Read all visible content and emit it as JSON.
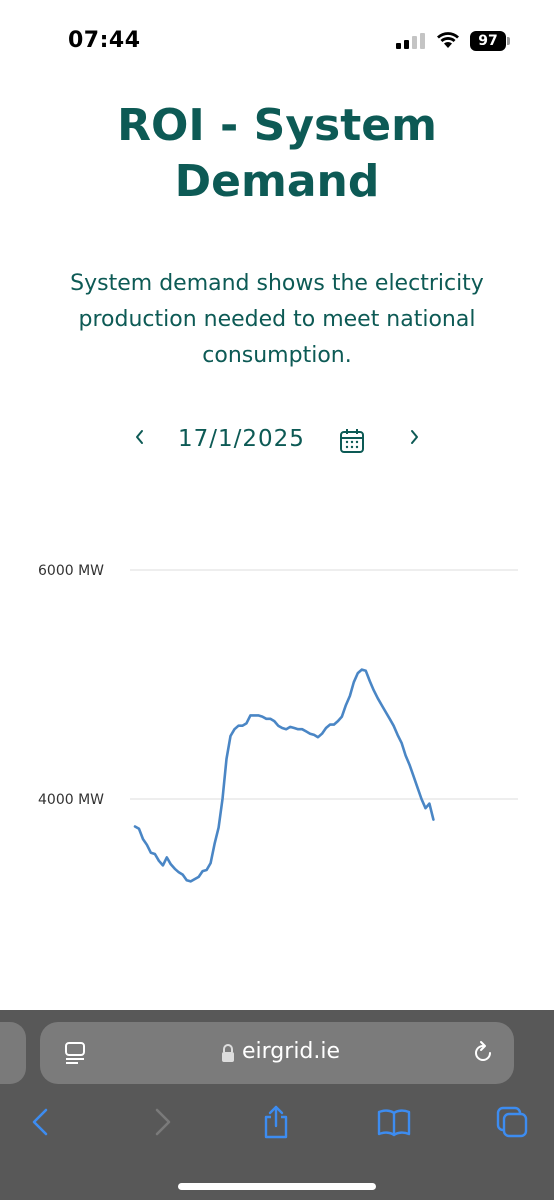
{
  "status_bar": {
    "time": "07:44",
    "battery": "97"
  },
  "header": {
    "title_line1": "ROI - System",
    "title_line2": "Demand",
    "description": "System demand shows the electricity production needed to meet national consumption."
  },
  "date_nav": {
    "date": "17/1/2025",
    "prev_icon": "chevron-left-icon",
    "next_icon": "chevron-right-icon",
    "calendar_icon": "calendar-icon"
  },
  "chart_data": {
    "type": "line",
    "title": "",
    "xlabel": "",
    "ylabel": "",
    "y_ticks": [
      "6000 MW",
      "4000 MW"
    ],
    "y_tick_values": [
      6000,
      4000
    ],
    "ylim": [
      3000,
      6400
    ],
    "grid": true,
    "legend": "none",
    "line_color": "#4a86c5",
    "x": [
      0,
      1,
      2,
      3,
      4,
      5,
      6,
      7,
      8,
      9,
      10,
      11,
      12,
      13,
      14,
      15,
      16,
      17,
      18,
      19,
      20,
      21,
      22,
      23,
      24,
      25,
      26,
      27,
      28,
      29,
      30,
      31,
      32,
      33,
      34,
      35,
      36,
      37,
      38,
      39,
      40,
      41,
      42,
      43,
      44,
      45,
      46,
      47,
      48,
      49,
      50,
      51,
      52,
      53,
      54,
      55,
      56,
      57,
      58,
      59,
      60,
      61,
      62,
      63,
      64,
      65,
      66,
      67,
      68,
      69,
      70,
      71,
      72,
      73,
      74,
      75,
      76,
      77,
      78,
      79,
      80,
      81,
      82,
      83,
      84,
      85,
      86,
      87,
      88,
      89,
      90,
      91,
      92,
      93,
      94,
      95
    ],
    "values": [
      3760,
      3740,
      3650,
      3600,
      3530,
      3520,
      3460,
      3420,
      3490,
      3430,
      3390,
      3360,
      3340,
      3290,
      3280,
      3300,
      3320,
      3370,
      3380,
      3440,
      3610,
      3750,
      4000,
      4350,
      4550,
      4610,
      4640,
      4640,
      4660,
      4730,
      4730,
      4730,
      4720,
      4700,
      4700,
      4680,
      4640,
      4620,
      4610,
      4630,
      4620,
      4610,
      4610,
      4590,
      4570,
      4560,
      4540,
      4570,
      4620,
      4650,
      4650,
      4680,
      4720,
      4820,
      4900,
      5020,
      5100,
      5130,
      5120,
      5030,
      4950,
      4880,
      4820,
      4760,
      4700,
      4640,
      4560,
      4490,
      4380,
      4300,
      4200,
      4100,
      4000,
      3920,
      3960,
      3820
    ]
  },
  "browser": {
    "url": "eirgrid.ie",
    "icons": [
      "reader-icon",
      "lock-icon",
      "reload-icon",
      "back-icon",
      "forward-icon",
      "share-icon",
      "bookmarks-icon",
      "tabs-icon"
    ]
  }
}
